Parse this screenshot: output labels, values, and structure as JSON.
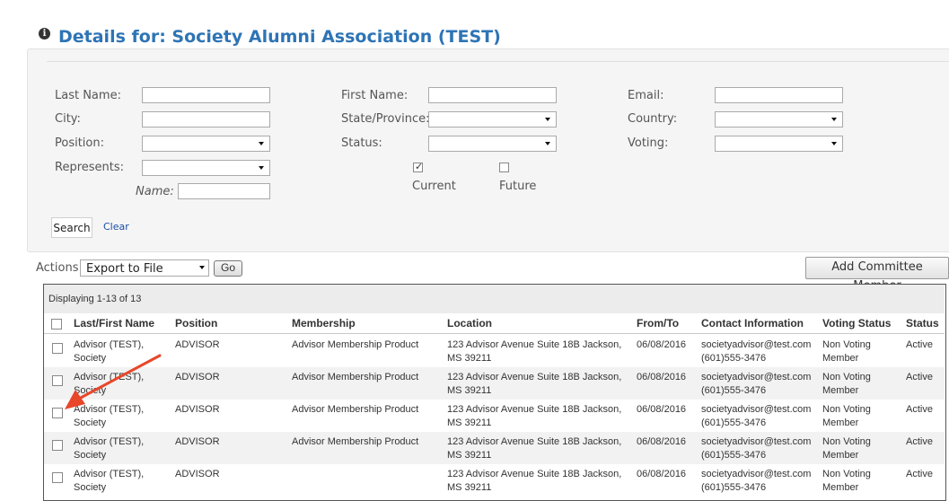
{
  "header": {
    "title": "Details for: Society Alumni Association (TEST)",
    "icon": "info-icon"
  },
  "filters": {
    "last_name": {
      "label": "Last Name:",
      "value": ""
    },
    "first_name": {
      "label": "First Name:",
      "value": ""
    },
    "email": {
      "label": "Email:",
      "value": ""
    },
    "city": {
      "label": "City:",
      "value": ""
    },
    "state": {
      "label": "State/Province:",
      "value": ""
    },
    "country": {
      "label": "Country:",
      "value": ""
    },
    "position": {
      "label": "Position:",
      "value": ""
    },
    "status": {
      "label": "Status:",
      "value": ""
    },
    "voting": {
      "label": "Voting:",
      "value": ""
    },
    "represents": {
      "label": "Represents:",
      "value": ""
    },
    "name": {
      "label": "Name:",
      "value": ""
    },
    "current": {
      "label": "Current",
      "checked": true
    },
    "future": {
      "label": "Future",
      "checked": false
    },
    "search_label": "Search",
    "clear_label": "Clear"
  },
  "actions": {
    "label": "Actions:",
    "selected": "Export to File",
    "go_label": "Go",
    "add_label": "Add Committee Member"
  },
  "grid": {
    "displaying": "Displaying 1-13 of 13",
    "columns": [
      "Last/First Name",
      "Position",
      "Membership",
      "Location",
      "From/To",
      "Contact Information",
      "Voting Status",
      "Status"
    ],
    "rows": [
      {
        "name1": "Advisor (TEST),",
        "name2": "Society",
        "position": "ADVISOR",
        "membership": "Advisor Membership Product",
        "loc1": "123 Advisor Avenue Suite 18B Jackson,",
        "loc2": "MS 39211",
        "from_to": "06/08/2016",
        "email": "societyadvisor@test.com",
        "phone": "(601)555-3476",
        "vote1": "Non Voting",
        "vote2": "Member",
        "status": "Active"
      },
      {
        "name1": "Advisor (TEST),",
        "name2": "Society",
        "position": "ADVISOR",
        "membership": "Advisor Membership Product",
        "loc1": "123 Advisor Avenue Suite 18B Jackson,",
        "loc2": "MS 39211",
        "from_to": "06/08/2016",
        "email": "societyadvisor@test.com",
        "phone": "(601)555-3476",
        "vote1": "Non Voting",
        "vote2": "Member",
        "status": "Active"
      },
      {
        "name1": "Advisor (TEST),",
        "name2": "Society",
        "position": "ADVISOR",
        "membership": "Advisor Membership Product",
        "loc1": "123 Advisor Avenue Suite 18B Jackson,",
        "loc2": "MS 39211",
        "from_to": "06/08/2016",
        "email": "societyadvisor@test.com",
        "phone": "(601)555-3476",
        "vote1": "Non Voting",
        "vote2": "Member",
        "status": "Active"
      },
      {
        "name1": "Advisor (TEST),",
        "name2": "Society",
        "position": "ADVISOR",
        "membership": "Advisor Membership Product",
        "loc1": "123 Advisor Avenue Suite 18B Jackson,",
        "loc2": "MS 39211",
        "from_to": "06/08/2016",
        "email": "societyadvisor@test.com",
        "phone": "(601)555-3476",
        "vote1": "Non Voting",
        "vote2": "Member",
        "status": "Active"
      },
      {
        "name1": "Advisor (TEST),",
        "name2": "Society",
        "position": "ADVISOR",
        "membership": "",
        "loc1": "123 Advisor Avenue Suite 18B Jackson,",
        "loc2": "MS 39211",
        "from_to": "06/08/2016",
        "email": "societyadvisor@test.com",
        "phone": "(601)555-3476",
        "vote1": "Non Voting",
        "vote2": "Member",
        "status": "Active"
      }
    ]
  },
  "annotation": {
    "arrow_color": "#e8472a"
  }
}
